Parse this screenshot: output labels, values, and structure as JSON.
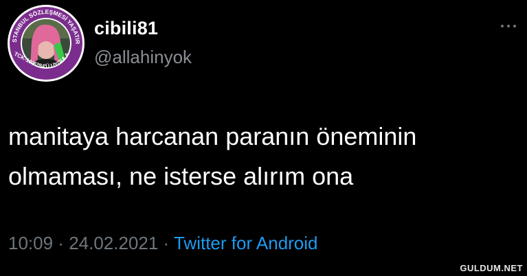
{
  "user": {
    "display_name": "cibili81",
    "handle": "@allahinyok",
    "avatar_ring_text_top": "İSTANBUL SÖZLEŞMESİ YAŞATIR",
    "avatar_ring_text_bottom": "6284'Ü UYGULA",
    "avatar_ring_text_left": "TCK-103"
  },
  "tweet": {
    "text_line_1": "manitaya harcanan paranın öneminin",
    "text_line_2": "olmaması, ne isterse alırım ona",
    "time": "10:09",
    "separator": " · ",
    "date": "24.02.2021",
    "source": "Twitter for Android"
  },
  "watermark": "GULDUM.NET",
  "colors": {
    "background": "#000000",
    "text": "#ffffff",
    "secondary": "#6e767d",
    "link": "#1d9bf0",
    "avatar_ring": "#7b2d8e"
  }
}
